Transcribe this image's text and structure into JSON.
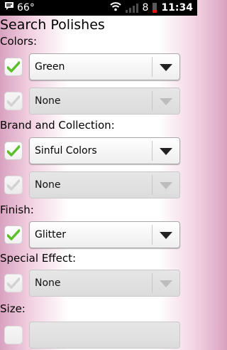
{
  "status": {
    "temperature": "66°",
    "signal_digit": "8",
    "time": "11:34"
  },
  "page": {
    "title": "Search Polishes"
  },
  "filters": {
    "colors_label": "Colors:",
    "color_primary": "Green",
    "color_secondary": "None",
    "brand_label": "Brand and Collection:",
    "brand_primary": "Sinful Colors",
    "brand_secondary": "None",
    "finish_label": "Finish:",
    "finish_primary": "Glitter",
    "special_label": "Special Effect:",
    "special_primary": "None",
    "size_label": "Size:"
  },
  "icons": {
    "notification": "message-icon",
    "wifi": "wifi-icon",
    "signal": "signal-icon",
    "battery": "battery-icon",
    "checkmark": "check-icon",
    "dropdown": "chevron-down-icon"
  },
  "colors": {
    "check_active": "#5bbf2a",
    "check_inactive": "#d2d2d2",
    "gradient_edge": "#d9a2c0"
  }
}
